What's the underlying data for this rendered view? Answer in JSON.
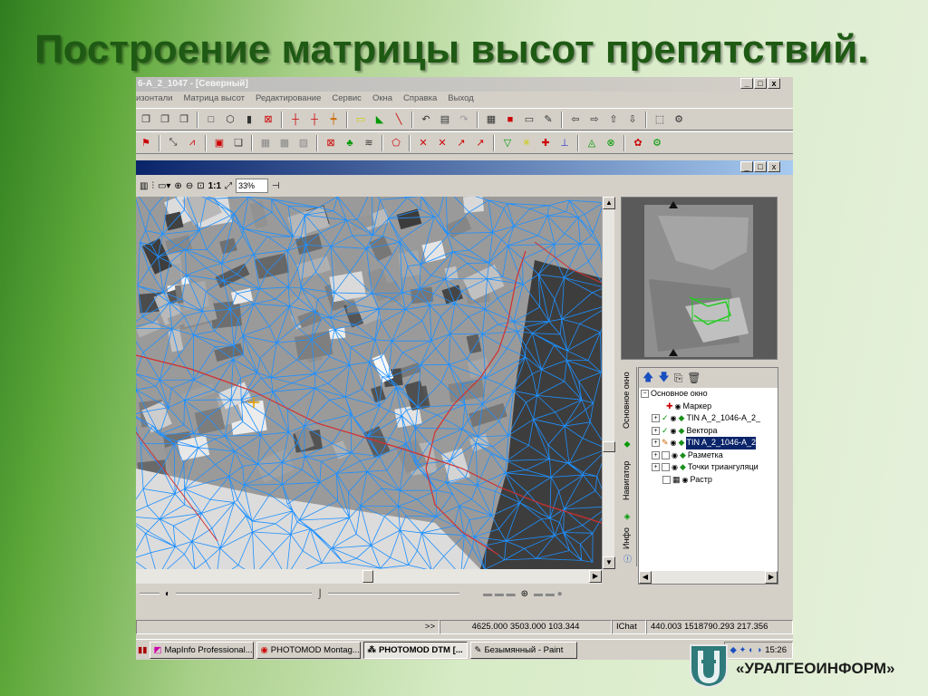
{
  "slide": {
    "title": "Построение матрицы высот препятствий.",
    "brand": "«УРАЛГЕОИНФОРМ»"
  },
  "window": {
    "title": "6-A_2_1047 - [Северный]",
    "buttons": [
      "_",
      "□",
      "x"
    ]
  },
  "menu": [
    "изонтали",
    "Матрица высот",
    "Редактирование",
    "Сервис",
    "Окна",
    "Справка",
    "Выход"
  ],
  "viewtoolbar": {
    "scale_label": "1:1",
    "zoom_value": "33%"
  },
  "layers": {
    "tools": [
      "arrow-up-icon",
      "arrow-down-icon",
      "copy-icon",
      "trash-icon"
    ],
    "root": "Основное окно",
    "items": [
      {
        "label": "Маркер",
        "selected": false
      },
      {
        "label": "TIN A_2_1046-A_2_",
        "selected": false
      },
      {
        "label": "Вектора",
        "selected": false
      },
      {
        "label": "TIN A_2_1046-A_2",
        "selected": true
      },
      {
        "label": "Разметка",
        "selected": false
      },
      {
        "label": "Точки триангуляци",
        "selected": false
      },
      {
        "label": "Растр",
        "selected": false
      }
    ]
  },
  "sidetabs": [
    "Основное окно",
    "Навигатор",
    "Инфо"
  ],
  "status": {
    "nav_glyph": ">>",
    "coords1": "4625.000 3503.000 103.344",
    "chat": "IChat",
    "coords2": "440.003 1518790.293 217.356"
  },
  "taskbar": {
    "items": [
      {
        "label": "MapInfo Professional...",
        "active": false
      },
      {
        "label": "PHOTOMOD Montag...",
        "active": false
      },
      {
        "label": "PHOTOMOD DTM [...",
        "active": true
      },
      {
        "label": "Безымянный - Paint",
        "active": false
      }
    ],
    "clock": "15:26"
  }
}
